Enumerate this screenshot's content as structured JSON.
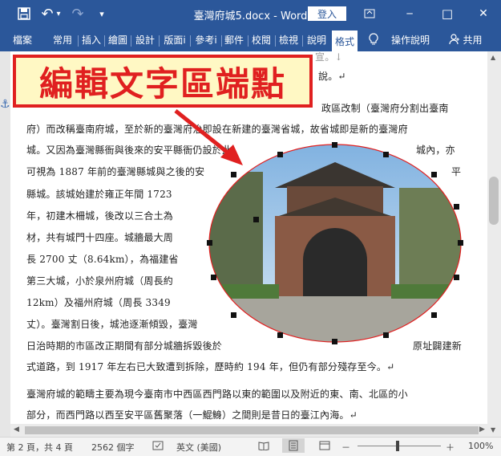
{
  "titlebar": {
    "save_icon": "save-icon",
    "undo_icon": "↶",
    "redo_icon": "↷",
    "dropdown_icon": "▾",
    "title": "臺灣府城5.docx  -  Word",
    "login_label": "登入",
    "minimize": "─",
    "maximize": "□",
    "close": "✕"
  },
  "ribbon": {
    "tabs": [
      "檔案",
      "常用",
      "插入",
      "繪圖",
      "設計",
      "版面i",
      "參考i",
      "郵件",
      "校閱",
      "檢視",
      "說明",
      "格式"
    ],
    "active_tab": "格式",
    "tell_me": "操作說明",
    "share": "共用"
  },
  "document": {
    "lines": [
      "宣。↓",
      "說。↵",
      "政區改制（臺灣府分割出臺南",
      "府）而改稱臺南府城，至於新的臺灣府治即設在新建的臺灣省城，故省城即是新的臺灣府",
      "城。又因為臺灣縣衙與後來的安平縣衙仍設於此",
      "城內，亦",
      "可視為 1887 年前的臺灣縣城與之後的安",
      "平",
      "縣城。該城始建於雍正年間 1723",
      "年，初建木柵城，後改以三合土為",
      "材，共有城門十四座。城牆最大周",
      "長 2700 丈（8.64km），為福建省",
      "第三大城，小於泉州府城（周長約",
      "12km）及福州府城（周長 3349",
      "丈）。臺灣割日後，城池逐漸傾毀，臺灣",
      "日治時期的市區改正期間有部分城牆拆毀後於",
      "原址闢建新",
      "式道路，到 1917 年左右已大致遭到拆除，歷時約 194 年，但仍有部分殘存至今。↵",
      "臺灣府城的範疇主要為現今臺南市中西區西門路以東的範圍以及附近的東、南、北區的小",
      "部分，而西門路以西至安平區舊聚落（一鯤鯓）之間則是昔日的臺江內海。↵"
    ],
    "anchor_icon": "⚓"
  },
  "callout": {
    "text": "編輯文字區端點"
  },
  "status": {
    "page": "第 2 頁，共 4 頁",
    "words": "2562 個字",
    "language": "英文 (美國)",
    "zoom_minus": "－",
    "zoom_plus": "＋",
    "zoom": "100%"
  },
  "colors": {
    "accent": "#2b579a",
    "callout_red": "#e02020",
    "callout_bg": "#fff8c4"
  }
}
